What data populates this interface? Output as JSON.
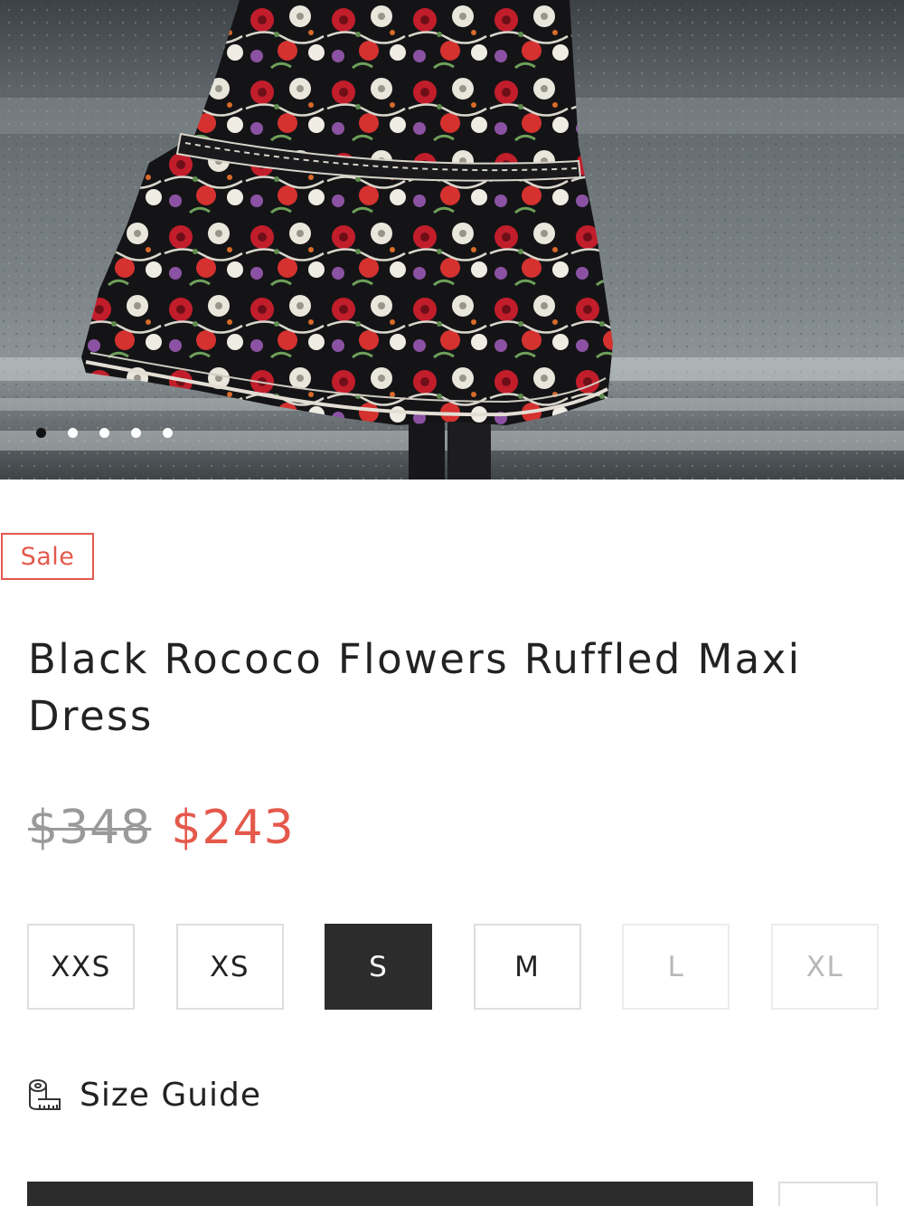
{
  "product": {
    "image_alt": "Model wearing black floral maxi dress",
    "badge": "Sale",
    "title": "Black Rococo Flowers Ruffled Maxi Dress",
    "price_original": "$348",
    "price_sale": "$243"
  },
  "carousel": {
    "slide_count": 5,
    "active_index": 0
  },
  "sizes": [
    {
      "label": "XXS",
      "state": "available"
    },
    {
      "label": "XS",
      "state": "available"
    },
    {
      "label": "S",
      "state": "selected"
    },
    {
      "label": "M",
      "state": "available"
    },
    {
      "label": "L",
      "state": "unavailable"
    },
    {
      "label": "XL",
      "state": "unavailable"
    }
  ],
  "size_guide": {
    "label": "Size Guide",
    "icon": "measuring-tape-icon"
  },
  "colors": {
    "accent_sale": "#e4594c",
    "selected_size_bg": "#2c2c2c",
    "disabled_text": "#b8b8b8"
  }
}
